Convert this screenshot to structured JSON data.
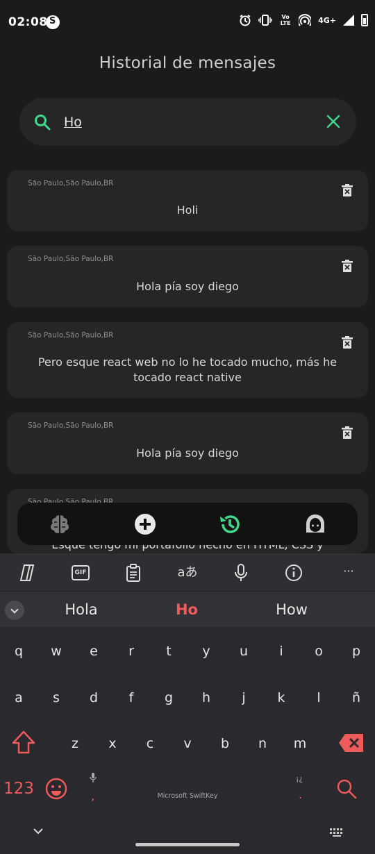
{
  "status_bar": {
    "time": "02:08",
    "network": "4G+",
    "volte": "Vo LTE"
  },
  "header": {
    "title": "Historial de mensajes"
  },
  "search": {
    "value": "Ho",
    "placeholder": ""
  },
  "messages": [
    {
      "location": "São Paulo,São Paulo,BR",
      "text": "Holi"
    },
    {
      "location": "São Paulo,São Paulo,BR",
      "text": "Hola pía soy diego"
    },
    {
      "location": "São Paulo,São Paulo,BR",
      "text": "Pero esque react web no lo he tocado mucho, más he tocado react native"
    },
    {
      "location": "São Paulo,São Paulo,BR",
      "text": "Hola pía soy diego"
    },
    {
      "location": "São Paulo,São Paulo,BR",
      "text": "Esque tengo mi portafolio hecho en HTML, CSS y"
    }
  ],
  "bottom_nav": {
    "items": [
      {
        "icon": "brain-icon"
      },
      {
        "icon": "add-circle-icon"
      },
      {
        "icon": "history-icon",
        "active": true
      },
      {
        "icon": "girl-avatar-icon"
      }
    ],
    "active_color": "#3fd98c"
  },
  "keyboard": {
    "toolbar": [
      "copilot-icon",
      "gif-icon",
      "clipboard-icon",
      "translate-icon",
      "microphone-icon",
      "info-icon",
      "more-icon"
    ],
    "gif_label": "GIF",
    "translate_label": "aあ",
    "more_label": "···",
    "suggestions": [
      "Hola",
      "Ho",
      "How"
    ],
    "row1": [
      "q",
      "w",
      "e",
      "r",
      "t",
      "y",
      "u",
      "i",
      "o",
      "p"
    ],
    "row2": [
      "a",
      "s",
      "d",
      "f",
      "g",
      "h",
      "j",
      "k",
      "l",
      "ñ"
    ],
    "row3": [
      "z",
      "x",
      "c",
      "v",
      "b",
      "n",
      "m"
    ],
    "numbers_label": "123",
    "brand": "Microsoft SwiftKey",
    "comma": ",",
    "period": ".",
    "punct_hint": "¡¿",
    "accent_color": "#ef5a5a"
  }
}
